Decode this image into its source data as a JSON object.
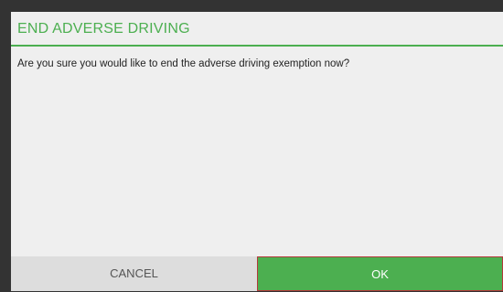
{
  "dialog": {
    "title": "END ADVERSE DRIVING",
    "message": "Are you sure you would like to end the adverse driving exemption now?",
    "cancel_label": "CANCEL",
    "ok_label": "OK"
  },
  "colors": {
    "accent": "#4caf50",
    "background": "#efefef",
    "backdrop": "#333333",
    "cancel_button": "#dddddd",
    "ok_border": "#b23a3a"
  }
}
